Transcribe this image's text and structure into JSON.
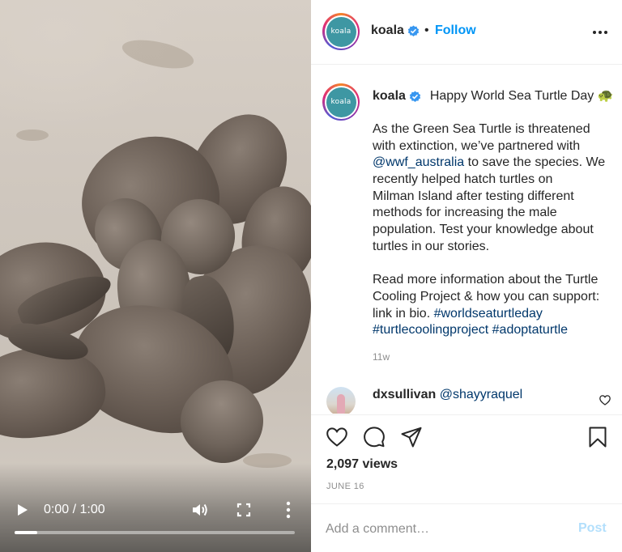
{
  "video": {
    "current_time": "0:00",
    "separator": " / ",
    "duration": "1:00",
    "progress_fraction": 0.08
  },
  "header": {
    "avatar_text": "koala",
    "username": "koala",
    "dot": "•",
    "follow_label": "Follow"
  },
  "caption": {
    "avatar_text": "koala",
    "username": "koala",
    "title": "Happy World Sea Turtle Day 🐢",
    "lines": [
      {
        "before": "As the Green Sea Turtle is threatened",
        "link": "",
        "after": ""
      },
      {
        "before": "with extinction, we’ve partnered with",
        "link": "",
        "after": ""
      },
      {
        "before": "",
        "link": "@wwf_australia",
        "after": " to save the species. We"
      },
      {
        "before": "recently helped hatch turtles on",
        "link": "",
        "after": ""
      },
      {
        "before": "Milman Island after testing different",
        "link": "",
        "after": ""
      },
      {
        "before": "methods for increasing the male",
        "link": "",
        "after": ""
      },
      {
        "before": "population. Test your knowledge about",
        "link": "",
        "after": ""
      },
      {
        "before": "turtles in our stories.",
        "link": "",
        "after": ""
      },
      {
        "before": "",
        "link": "",
        "after": ""
      },
      {
        "before": "Read more information about the Turtle",
        "link": "",
        "after": ""
      },
      {
        "before": "Cooling Project & how you can support:",
        "link": "",
        "after": ""
      },
      {
        "before": "link in bio. ",
        "link": "#worldseaturtleday",
        "after": ""
      },
      {
        "before": "",
        "link": "#turtlecoolingproject #adoptaturtle",
        "after": ""
      }
    ],
    "age": "11w"
  },
  "reply": {
    "username": "dxsullivan",
    "mention": "@shayyraquel"
  },
  "stats": {
    "views": "2,097 views",
    "date": "JUNE 16"
  },
  "comment_box": {
    "placeholder": "Add a comment…",
    "post_label": "Post"
  },
  "colors": {
    "accent": "#0095f6",
    "link": "#00376b",
    "muted": "#8e8e8e",
    "post_disabled": "#b2dffc",
    "brand_teal": "#3e97a3"
  },
  "icons": [
    "play-icon",
    "volume-icon",
    "fullscreen-icon",
    "more-vertical-icon",
    "verified-badge-icon",
    "more-horizontal-icon",
    "heart-icon",
    "comment-icon",
    "share-icon",
    "bookmark-icon",
    "small-heart-icon"
  ]
}
